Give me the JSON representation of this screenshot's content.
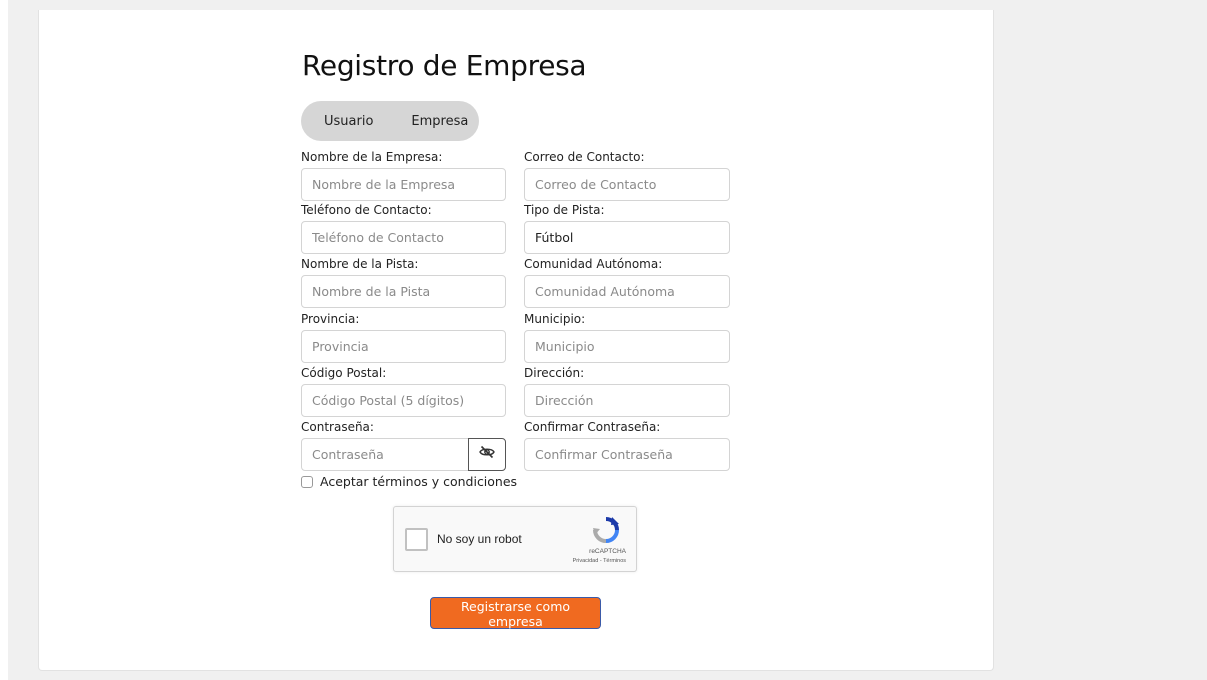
{
  "form": {
    "title": "Registro de Empresa",
    "toggle": {
      "user_label": "Usuario",
      "company_label": "Empresa"
    },
    "fields": {
      "company_name": {
        "label": "Nombre de la Empresa:",
        "placeholder": "Nombre de la Empresa",
        "value": ""
      },
      "contact_email": {
        "label": "Correo de Contacto:",
        "placeholder": "Correo de Contacto",
        "value": ""
      },
      "contact_phone": {
        "label": "Teléfono de Contacto:",
        "placeholder": "Teléfono de Contacto",
        "value": ""
      },
      "court_type": {
        "label": "Tipo de Pista:",
        "value": "Fútbol"
      },
      "court_name": {
        "label": "Nombre de la Pista:",
        "placeholder": "Nombre de la Pista",
        "value": ""
      },
      "region": {
        "label": "Comunidad Autónoma:",
        "placeholder": "Comunidad Autónoma",
        "value": ""
      },
      "province": {
        "label": "Provincia:",
        "placeholder": "Provincia",
        "value": ""
      },
      "municipality": {
        "label": "Municipio:",
        "placeholder": "Municipio",
        "value": ""
      },
      "postal_code": {
        "label": "Código Postal:",
        "placeholder": "Código Postal (5 dígitos)",
        "value": ""
      },
      "address": {
        "label": "Dirección:",
        "placeholder": "Dirección",
        "value": ""
      },
      "password": {
        "label": "Contraseña:",
        "placeholder": "Contraseña",
        "value": ""
      },
      "confirm_password": {
        "label": "Confirmar Contraseña:",
        "placeholder": "Confirmar Contraseña",
        "value": ""
      }
    },
    "password_toggle_icon": "eye-slash-icon",
    "terms_label": "Aceptar términos y condiciones",
    "terms_checked": false,
    "captcha": {
      "label": "No soy un robot",
      "brand": "reCAPTCHA",
      "links": "Privacidad - Términos",
      "icon": "recaptcha-logo-icon"
    },
    "submit_label": "Registrarse como empresa",
    "colors": {
      "accent": "#f06a20",
      "submit_border": "#3b5aa8",
      "toggle_bg": "#d6d6d6"
    }
  }
}
